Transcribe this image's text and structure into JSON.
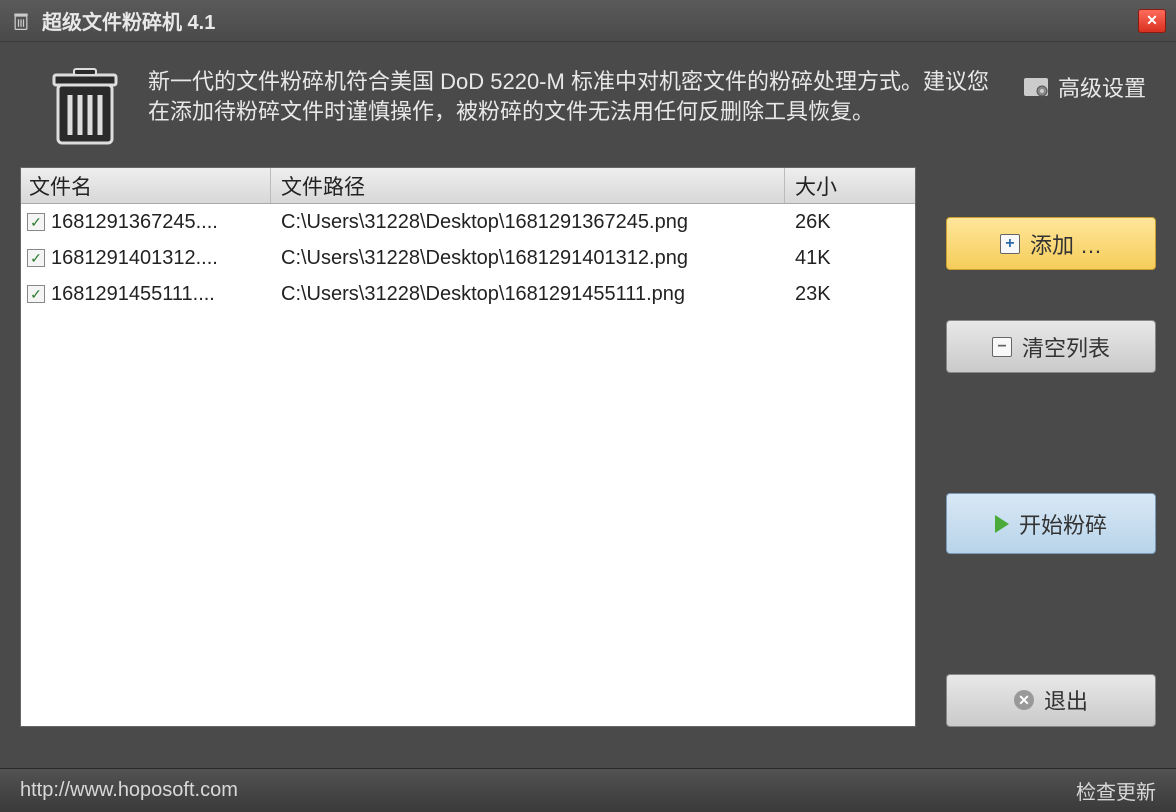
{
  "app": {
    "title": "超级文件粉碎机 4.1"
  },
  "header": {
    "description": "新一代的文件粉碎机符合美国 DoD 5220-M 标准中对机密文件的粉碎处理方式。建议您在添加待粉碎文件时谨慎操作，被粉碎的文件无法用任何反删除工具恢复。",
    "advanced_settings": "高级设置"
  },
  "table": {
    "columns": {
      "name": "文件名",
      "path": "文件路径",
      "size": "大小"
    },
    "rows": [
      {
        "checked": true,
        "name": "1681291367245....",
        "path": "C:\\Users\\31228\\Desktop\\1681291367245.png",
        "size": "26K"
      },
      {
        "checked": true,
        "name": "1681291401312....",
        "path": "C:\\Users\\31228\\Desktop\\1681291401312.png",
        "size": "41K"
      },
      {
        "checked": true,
        "name": "1681291455111....",
        "path": "C:\\Users\\31228\\Desktop\\1681291455111.png",
        "size": "23K"
      }
    ]
  },
  "buttons": {
    "add": "添加 …",
    "clear": "清空列表",
    "start": "开始粉碎",
    "exit": "退出"
  },
  "footer": {
    "url": "http://www.hoposoft.com",
    "update": "检查更新"
  }
}
